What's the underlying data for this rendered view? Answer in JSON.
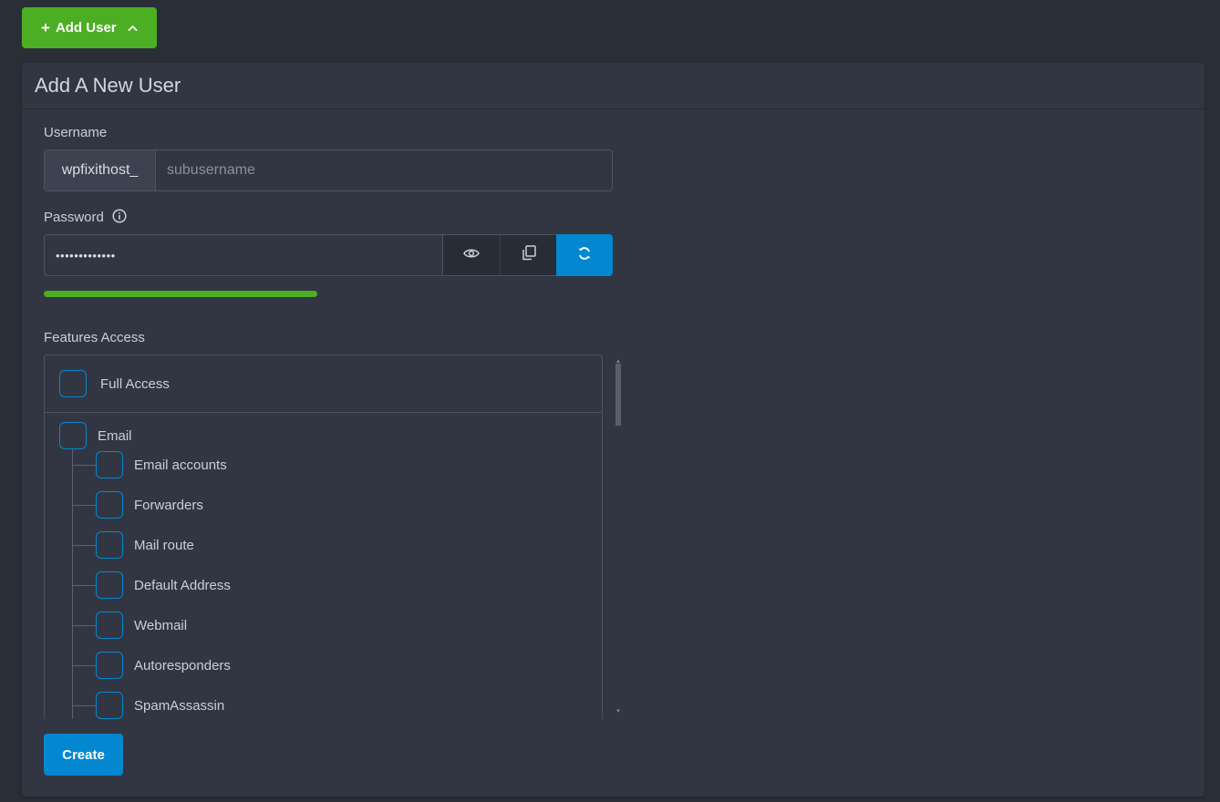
{
  "header": {
    "add_user_label": "Add User"
  },
  "panel": {
    "title": "Add A New User"
  },
  "username": {
    "label": "Username",
    "prefix": "wpfixithost_",
    "placeholder": "subusername",
    "value": ""
  },
  "password": {
    "label": "Password",
    "masked_value": "•••••••••••••",
    "strength": 1.0,
    "strength_color": "#4cae23"
  },
  "features": {
    "label": "Features Access",
    "full_access_label": "Full Access",
    "group_label": "Email",
    "children": [
      "Email accounts",
      "Forwarders",
      "Mail route",
      "Default Address",
      "Webmail",
      "Autoresponders",
      "SpamAssassin"
    ]
  },
  "actions": {
    "create_label": "Create"
  },
  "colors": {
    "accent_blue": "#0287d0",
    "accent_green": "#4cae23",
    "background": "#2a2e37",
    "panel": "#323642"
  }
}
